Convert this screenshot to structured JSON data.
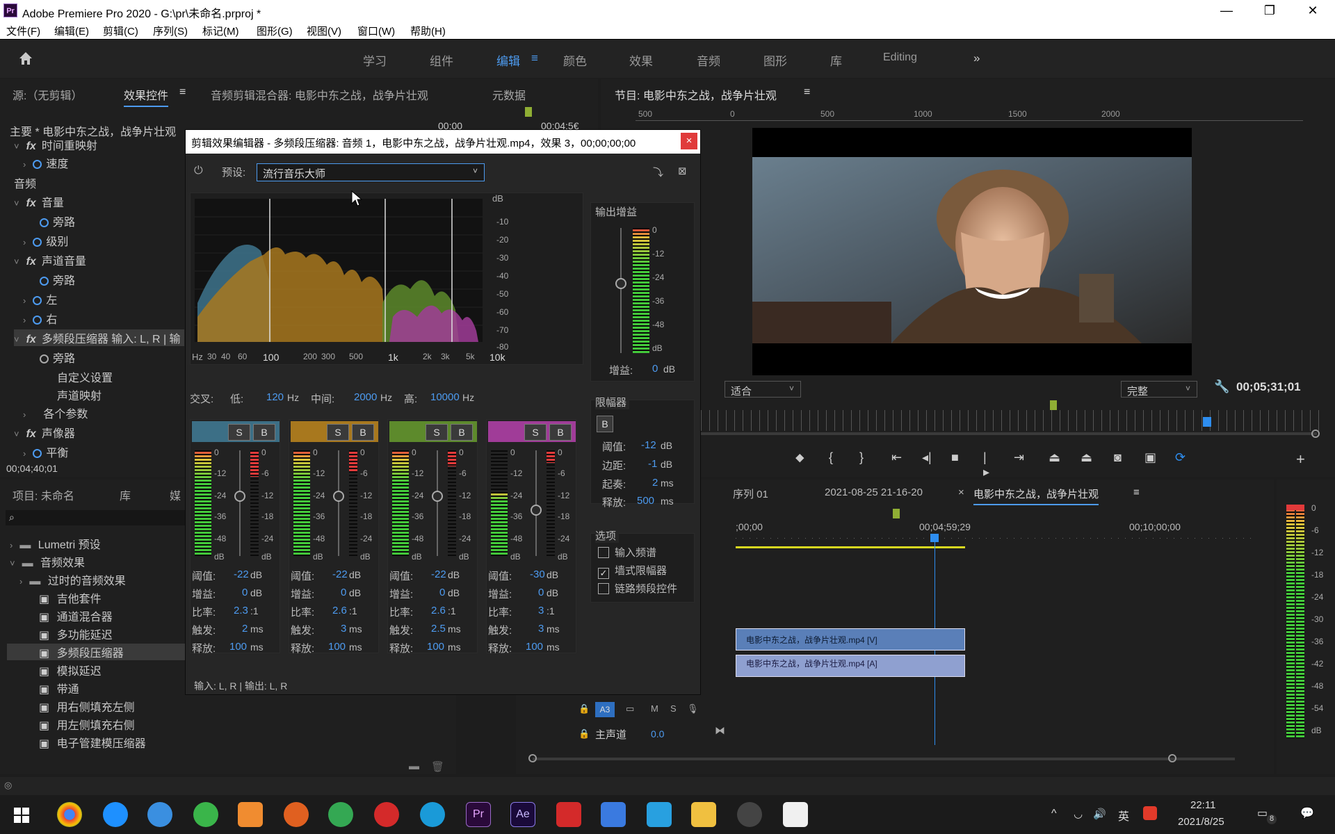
{
  "window": {
    "title": "Adobe Premiere Pro 2020 - G:\\pr\\未命名.prproj *",
    "app_badge": "Pr",
    "controls": [
      "—",
      "❐",
      "✕"
    ]
  },
  "menu": [
    "文件(F)",
    "编辑(E)",
    "剪辑(C)",
    "序列(S)",
    "标记(M)",
    "图形(G)",
    "视图(V)",
    "窗口(W)",
    "帮助(H)"
  ],
  "workspaces": [
    "学习",
    "组件",
    "编辑",
    "颜色",
    "效果",
    "音频",
    "图形",
    "库",
    "Editing"
  ],
  "workspace_active_index": 2,
  "left_tabs": [
    "源:（无剪辑）",
    "效果控件",
    "音频剪辑混合器: 电影中东之战，战争片壮观",
    "元数据"
  ],
  "ec": {
    "master": "主要 * 电影中东之战，战争片壮观",
    "clip_link": "电影中东之战，战争片壮观",
    "time_left": "00:00",
    "time_right": "00:04:5€",
    "rows": [
      "时间重映射",
      "速度",
      "音频",
      "音量",
      "旁路",
      "级别",
      "声道音量",
      "旁路",
      "左",
      "右",
      "多频段压缩器 输入: L, R | 输",
      "旁路",
      "自定义设置",
      "声道映射",
      "各个参数",
      "声像器",
      "平衡"
    ],
    "timecode": "00;04;40;01"
  },
  "program": {
    "title": "节目: 电影中东之战，战争片壮观",
    "ruler": [
      "500",
      "0",
      "500",
      "1000",
      "1500",
      "2000"
    ],
    "fit": "适合",
    "quality": "完整",
    "timecode": "00;05;31;01"
  },
  "project": {
    "tabs": [
      "项目: 未命名",
      "库",
      "媒"
    ],
    "items": [
      "Lumetri 预设",
      "音频效果",
      "过时的音频效果",
      "吉他套件",
      "通道混合器",
      "多功能延迟",
      "多频段压缩器",
      "模拟延迟",
      "带通",
      "用右侧填充左侧",
      "用左侧填充右侧",
      "电子管建模压缩器"
    ]
  },
  "dialog": {
    "title": "剪辑效果编辑器 - 多频段压缩器: 音频 1，电影中东之战，战争片壮观.mp4，效果 3，00;00;00;00",
    "close": "×",
    "preset_label": "预设:",
    "preset_value": "流行音乐大师",
    "db_label": "dB",
    "db_ticks": [
      "-10",
      "-20",
      "-30",
      "-40",
      "-50",
      "-60",
      "-70",
      "-80"
    ],
    "freq_ticks": [
      "Hz",
      "30",
      "40",
      "60",
      "100",
      "200",
      "300",
      "500",
      "1k",
      "2k",
      "3k",
      "5k",
      "10k"
    ],
    "crossover": {
      "label": "交叉:",
      "low_label": "低:",
      "low": "120",
      "mid_label": "中间:",
      "mid": "2000",
      "high_label": "高:",
      "high": "10000",
      "unit": "Hz"
    },
    "bands": [
      {
        "color": "#3c6f86",
        "threshold": "-22",
        "gain": "0",
        "ratio": "2.3",
        "attack": "2",
        "release": "100"
      },
      {
        "color": "#a8781e",
        "threshold": "-22",
        "gain": "0",
        "ratio": "2.6",
        "attack": "3",
        "release": "100"
      },
      {
        "color": "#5d8a2c",
        "threshold": "-22",
        "gain": "0",
        "ratio": "2.6",
        "attack": "2.5",
        "release": "100"
      },
      {
        "color": "#a03c98",
        "threshold": "-30",
        "gain": "0",
        "ratio": "3",
        "attack": "3",
        "release": "100"
      }
    ],
    "band_labels": {
      "s": "S",
      "b": "B",
      "threshold": "阈值:",
      "gain": "增益:",
      "ratio": "比率:",
      "attack": "触发:",
      "release": "释放:",
      "db": "dB",
      "ms": "ms",
      "ratio_suffix": ":1"
    },
    "meter_scale": [
      "0",
      "-12",
      "-24",
      "-36",
      "-48",
      "dB"
    ],
    "meter_scale2": [
      "0",
      "-6",
      "-12",
      "-18",
      "-24",
      "dB"
    ],
    "output": {
      "label": "输出增益",
      "gain_label": "增益:",
      "gain": "0",
      "unit": "dB"
    },
    "limiter": {
      "label": "限幅器",
      "b": "B",
      "threshold_label": "阈值:",
      "threshold": "-12",
      "margin_label": "边距:",
      "margin": "-1",
      "attack_label": "起奏:",
      "attack": "2",
      "release_label": "释放:",
      "release": "500"
    },
    "options": {
      "label": "选项",
      "items": [
        {
          "label": "输入频谱",
          "checked": false
        },
        {
          "label": "墙式限幅器",
          "checked": true
        },
        {
          "label": "链路频段控件",
          "checked": false
        }
      ]
    },
    "io": "输入: L, R | 输出: L, R"
  },
  "timeline": {
    "tabs": [
      "序列 01",
      "2021-08-25 21-16-20",
      "电影中东之战，战争片壮观"
    ],
    "times": [
      ";00;00",
      "00;04;59;29",
      "00;10;00;00"
    ],
    "clip_v": "电影中东之战，战争片壮观.mp4 [V]",
    "clip_a": "电影中东之战，战争片壮观.mp4 [A]",
    "track_a3": "A3",
    "track_m": "M",
    "track_s": "S",
    "master_label": "主声道",
    "master_value": "0.0"
  },
  "right_meter": [
    "0",
    "-6",
    "-12",
    "-18",
    "-24",
    "-30",
    "-36",
    "-42",
    "-48",
    "-54",
    "dB"
  ],
  "taskbar": {
    "time": "22:11",
    "date": "2021/8/25",
    "ime": "英",
    "notifications": "8"
  }
}
